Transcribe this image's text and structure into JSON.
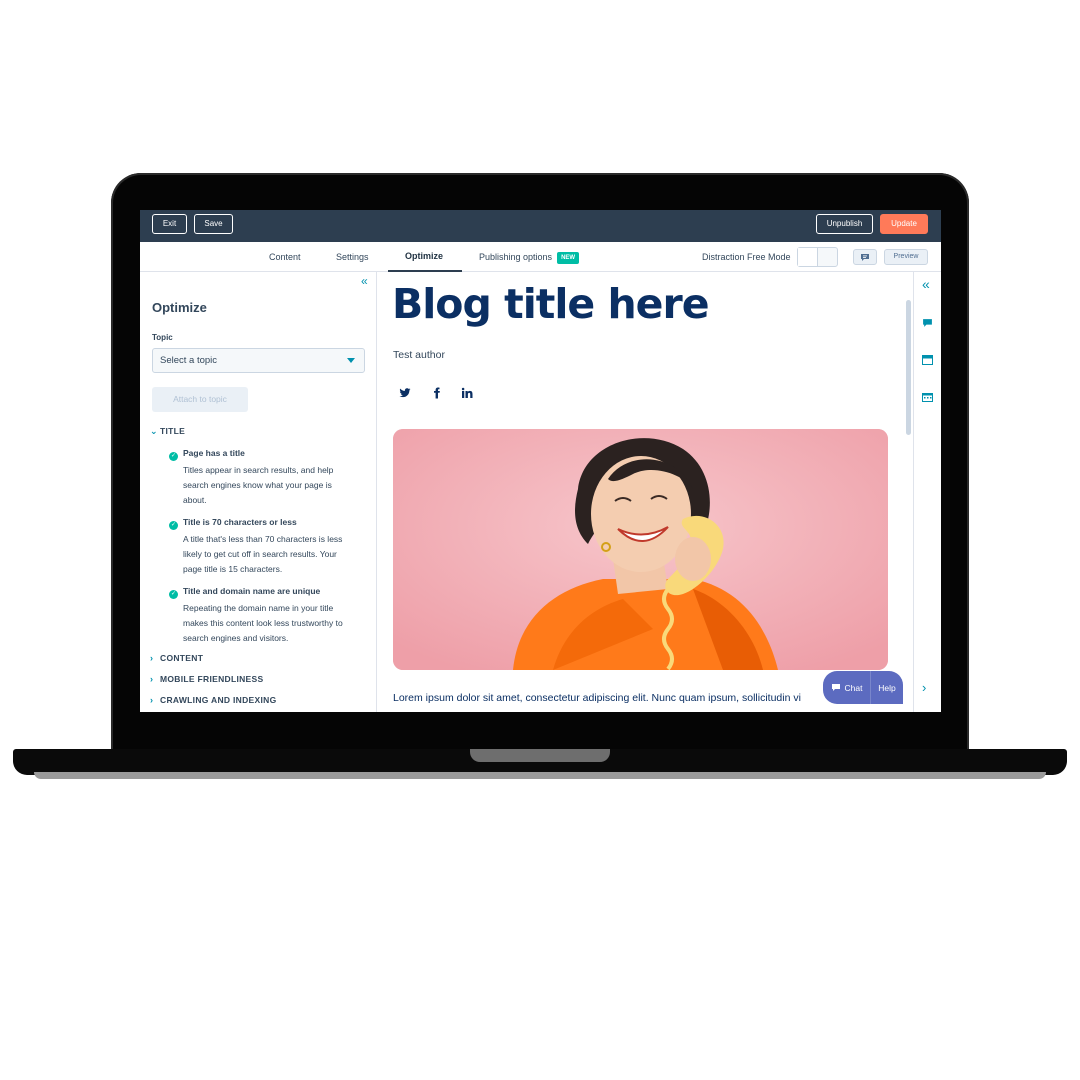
{
  "toolbar": {
    "exit_label": "Exit",
    "save_label": "Save",
    "unpublish_label": "Unpublish",
    "update_label": "Update"
  },
  "tabs": [
    {
      "label": "Content"
    },
    {
      "label": "Settings"
    },
    {
      "label": "Optimize",
      "active": true
    },
    {
      "label": "Publishing options",
      "badge": "NEW"
    }
  ],
  "distraction_free": {
    "label": "Distraction Free Mode",
    "enabled": false
  },
  "preview_label": "Preview",
  "sidebar": {
    "title": "Optimize",
    "topic_label": "Topic",
    "topic_placeholder": "Select a topic",
    "attach_label": "Attach to topic",
    "sections": [
      {
        "label": "TITLE",
        "expanded": true,
        "checks": [
          {
            "title": "Page has a title",
            "desc": [
              "Titles appear in search results, and help",
              "search engines know what your page is",
              "about."
            ]
          },
          {
            "title": "Title is 70 characters or less",
            "desc": [
              "A title that's less than 70 characters is less",
              "likely to get cut off in search results. Your",
              "page title is 15 characters."
            ]
          },
          {
            "title": "Title and domain name are unique",
            "desc": [
              "Repeating the domain name in your title",
              "makes this content look less trustworthy to",
              "search engines and visitors."
            ]
          }
        ]
      },
      {
        "label": "CONTENT",
        "expanded": false
      },
      {
        "label": "MOBILE FRIENDLINESS",
        "expanded": false
      },
      {
        "label": "CRAWLING AND INDEXING",
        "expanded": false
      }
    ]
  },
  "editor": {
    "blog_title": "Blog title here",
    "author": "Test author",
    "social_icons": [
      "twitter-icon",
      "facebook-icon",
      "linkedin-icon"
    ],
    "body_text": "Lorem ipsum dolor sit amet, consectetur adipiscing elit. Nunc quam ipsum, sollicitudin vi"
  },
  "chat_widget": {
    "chat_label": "Chat",
    "help_label": "Help"
  },
  "colors": {
    "topbar": "#2d3e50",
    "update_button": "#ff7a59",
    "accent": "#0091ae",
    "check": "#00bda5",
    "title_blue": "#0b2f63",
    "chat": "#5c6bc0"
  }
}
